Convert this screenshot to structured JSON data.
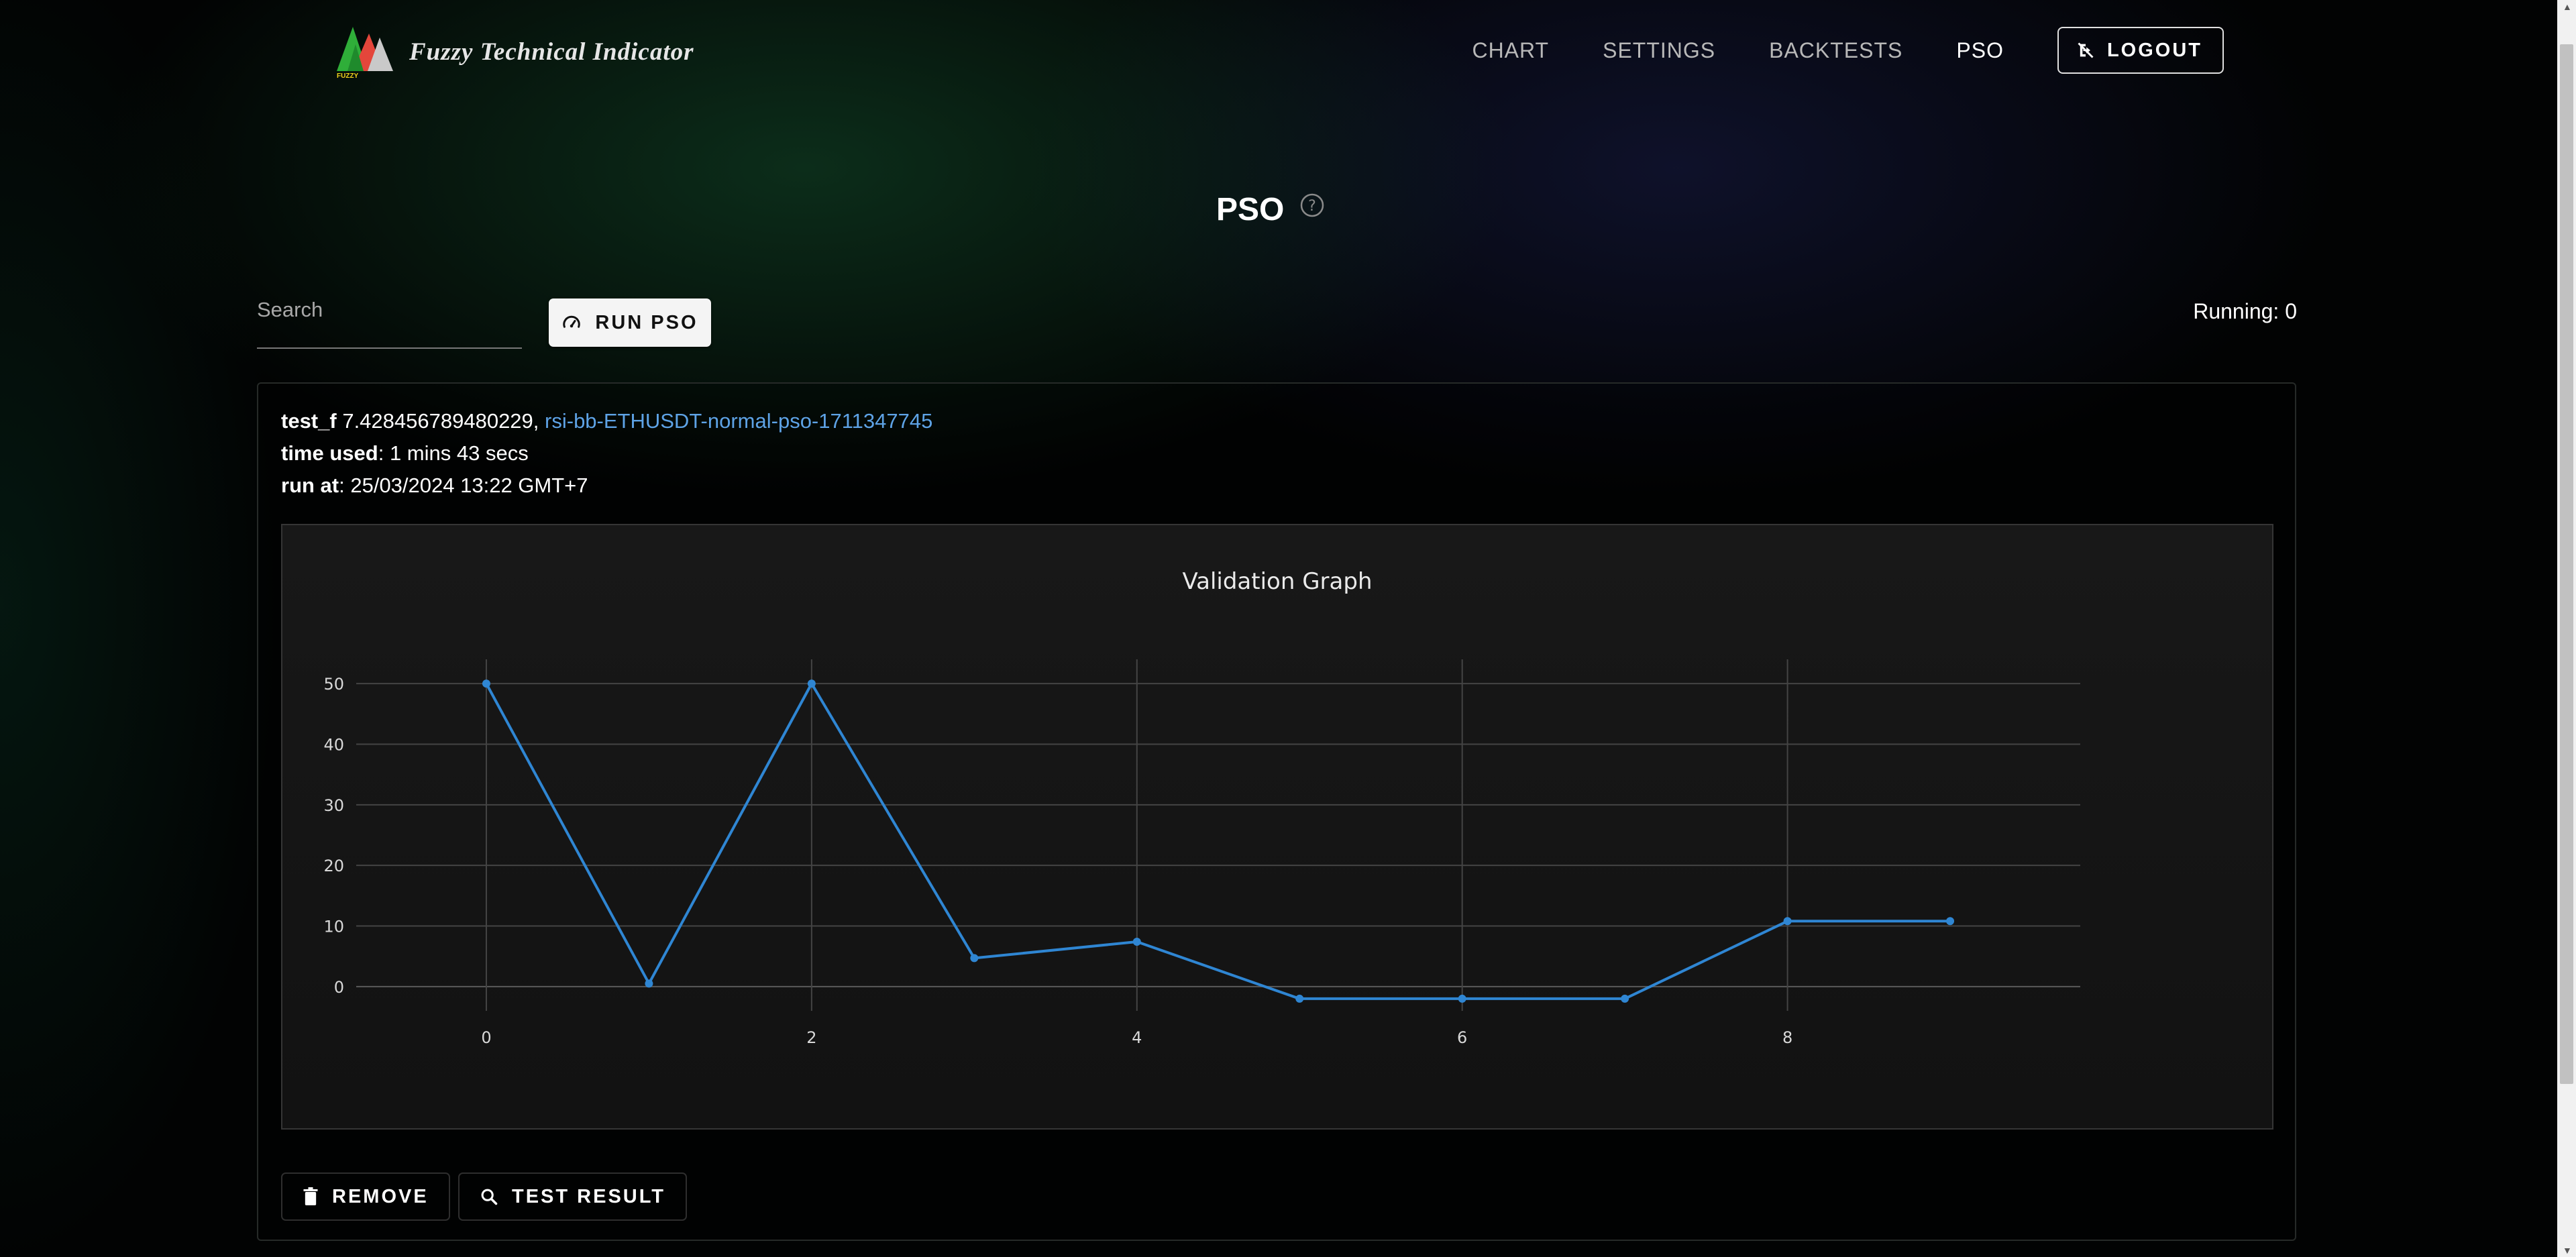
{
  "header": {
    "logo_title": "Fuzzy Technical Indicator",
    "logo_small": "FUZZY",
    "nav": [
      {
        "label": "CHART"
      },
      {
        "label": "SETTINGS"
      },
      {
        "label": "BACKTESTS"
      },
      {
        "label": "PSO",
        "active": true
      }
    ],
    "logout_label": "LOGOUT"
  },
  "page": {
    "title": "PSO"
  },
  "toolbar": {
    "search_placeholder": "Search",
    "search_value": "",
    "run_label": "RUN PSO",
    "running_text": "Running: 0"
  },
  "result": {
    "test_f_label": "test_f",
    "test_f_value": "7.428456789480229,",
    "link_text": "rsi-bb-ETHUSDT-normal-pso-1711347745",
    "time_used_label": "time used",
    "time_used_value": ": 1 mins 43 secs",
    "run_at_label": "run at",
    "run_at_value": ": 25/03/2024 13:22 GMT+7",
    "remove_label": "REMOVE",
    "test_result_label": "TEST RESULT"
  },
  "chart_data": {
    "type": "line",
    "title": "Validation Graph",
    "x": [
      0,
      1,
      2,
      3,
      4,
      5,
      6,
      7,
      8,
      9
    ],
    "series": [
      {
        "values": [
          50,
          0.5,
          50,
          4.7,
          7.4,
          -2,
          -2,
          -2,
          10.8,
          10.8
        ]
      }
    ],
    "xticks": [
      0,
      2,
      4,
      6,
      8
    ],
    "yticks": [
      0,
      10,
      20,
      30,
      40,
      50
    ],
    "xlim": [
      -0.8,
      9.8
    ],
    "ylim": [
      -4,
      54
    ],
    "line_color": "#2f86d3",
    "grid": true
  },
  "colors": {
    "link": "#5ea3e6",
    "background": "#020303",
    "series": "#2f86d3"
  }
}
